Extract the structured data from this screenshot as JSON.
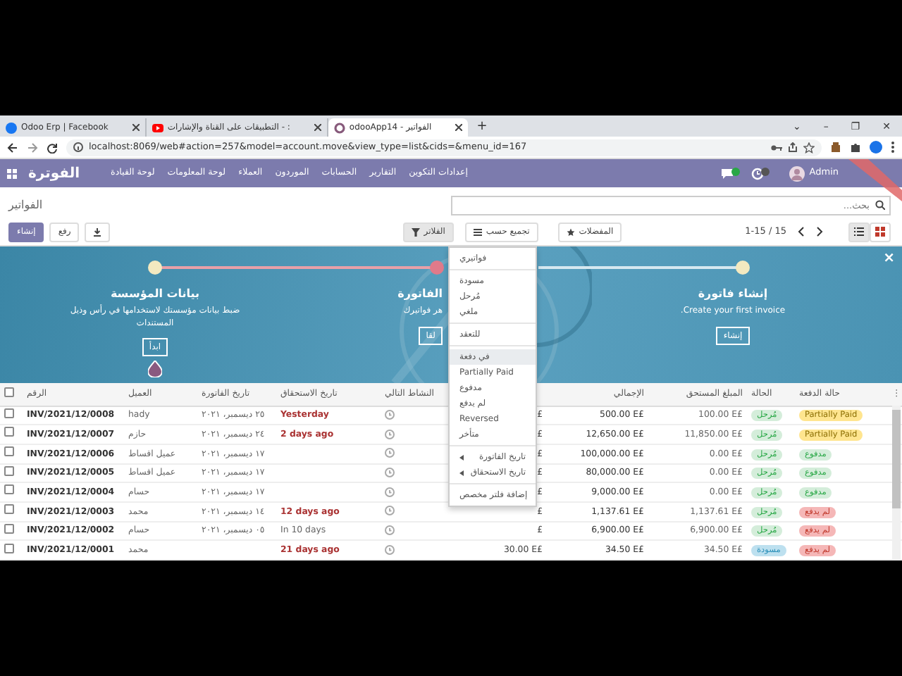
{
  "browser": {
    "tabs": [
      {
        "title": "odooApp14 - الفواتير",
        "selected": true
      },
      {
        "title": "التطبيقات على القناة والإشارات - :",
        "selected": false
      },
      {
        "title": "Odoo Erp | Facebook",
        "selected": false
      }
    ],
    "new_tab": "+",
    "window_controls": [
      "✕",
      "❐",
      "–",
      "⌄"
    ],
    "url": "localhost:8069/web#action=257&model=account.move&view_type=list&cids=&menu_id=167"
  },
  "navbar": {
    "app": "الفوترة",
    "menus": [
      "إعدادات التكوين",
      "التقارير",
      "الحسابات",
      "الموردون",
      "العملاء",
      "لوحة المعلومات",
      "لوحة القيادة"
    ],
    "user": "Admin"
  },
  "control_panel": {
    "title": "الفواتير",
    "search_placeholder": "بحث...",
    "buttons": [
      "رفع",
      "إنشاء"
    ],
    "filters": [
      {
        "label": "المفضلات",
        "selected": false
      },
      {
        "label": "تجميع حسب",
        "selected": false
      },
      {
        "label": "الفلاتر",
        "selected": true
      }
    ],
    "pager": "1-15 / 15",
    "views": [
      {
        "kind": "list",
        "selected": true
      },
      {
        "kind": "kanban",
        "selected": false
      }
    ]
  },
  "banner": {
    "close": "×",
    "steps": [
      {
        "title": "إنشاء فاتورة",
        "description": "Create your first invoice.",
        "button": "إنشاء",
        "current": false
      },
      {
        "title": "الفاتورة",
        "description": "هر فواتيرك",
        "button": "لقا",
        "current": true
      },
      {
        "title": "بيانات المؤسسة",
        "description": "ضبط بيانات مؤسستك لاستخدامها في رأس وذيل المستندات",
        "button": "ابدأ",
        "current": false
      }
    ]
  },
  "filter_menu": [
    {
      "kind": "item",
      "label": "فواتيري",
      "selected": false
    },
    {
      "kind": "divider"
    },
    {
      "kind": "item",
      "label": "مسودة",
      "selected": false
    },
    {
      "kind": "item",
      "label": "مُرحل",
      "selected": false
    },
    {
      "kind": "item",
      "label": "ملغي",
      "selected": false
    },
    {
      "kind": "divider"
    },
    {
      "kind": "item",
      "label": "للتعقد",
      "selected": false
    },
    {
      "kind": "divider"
    },
    {
      "kind": "item",
      "label": "في دفعة",
      "selected": true
    },
    {
      "kind": "item",
      "label": "Partially Paid",
      "selected": false
    },
    {
      "kind": "item",
      "label": "مدفوع",
      "selected": false
    },
    {
      "kind": "item",
      "label": "لم يدفع",
      "selected": false
    },
    {
      "kind": "item",
      "label": "Reversed",
      "selected": false
    },
    {
      "kind": "item",
      "label": "متأخر",
      "selected": false
    },
    {
      "kind": "divider"
    },
    {
      "kind": "submenu",
      "label": "تاريخ الفاتورة",
      "selected": false
    },
    {
      "kind": "submenu",
      "label": "تاريخ الاستحقاق",
      "selected": false
    },
    {
      "kind": "divider"
    },
    {
      "kind": "item",
      "label": "إضافة فلتر مخصص",
      "selected": false
    }
  ],
  "table": {
    "columns": [
      "حالة الدفعة",
      "الحالة",
      "المبلغ المستحق",
      "الإجمالي",
      "النشاط التالي",
      "تاريخ الاستحقاق",
      "تاريخ الفاتورة",
      "العميل",
      "الرقم"
    ],
    "menu": "⋮",
    "all_checked": false,
    "rows": [
      {
        "checked": false,
        "number": "INV/2021/12/0008",
        "customer": "hady",
        "invoice_date": "٢٥ ديسمبر، ٢٠٢١",
        "due_date": "Yesterday",
        "overdue": true,
        "column_7": "£",
        "total": "500.00 E£",
        "amount_due": "100.00 E£",
        "state": {
          "label": "مُرحل",
          "kind": "posted"
        },
        "payment": {
          "label": "Partially Paid",
          "kind": "partial"
        }
      },
      {
        "checked": false,
        "number": "INV/2021/12/0007",
        "customer": "حازم",
        "invoice_date": "٢٤ ديسمبر، ٢٠٢١",
        "due_date": "2 days ago",
        "overdue": true,
        "column_7": "£",
        "total": "12,650.00 E£",
        "amount_due": "11,850.00 E£",
        "state": {
          "label": "مُرحل",
          "kind": "posted"
        },
        "payment": {
          "label": "Partially Paid",
          "kind": "partial"
        }
      },
      {
        "checked": false,
        "number": "INV/2021/12/0006",
        "customer": "عميل اقساط",
        "invoice_date": "١٧ ديسمبر، ٢٠٢١",
        "column_7": "£",
        "total": "100,000.00 E£",
        "amount_due": "0.00 E£",
        "state": {
          "label": "مُرحل",
          "kind": "posted"
        },
        "payment": {
          "label": "مدفوع",
          "kind": "paid"
        }
      },
      {
        "checked": false,
        "number": "INV/2021/12/0005",
        "customer": "عميل اقساط",
        "invoice_date": "١٧ ديسمبر، ٢٠٢١",
        "column_7": "£",
        "total": "80,000.00 E£",
        "amount_due": "0.00 E£",
        "state": {
          "label": "مُرحل",
          "kind": "posted"
        },
        "payment": {
          "label": "مدفوع",
          "kind": "paid"
        }
      },
      {
        "checked": false,
        "number": "INV/2021/12/0004",
        "customer": "حسام",
        "invoice_date": "١٧ ديسمبر، ٢٠٢١",
        "column_7": "£",
        "total": "9,000.00 E£",
        "amount_due": "0.00 E£",
        "state": {
          "label": "مُرحل",
          "kind": "posted"
        },
        "payment": {
          "label": "مدفوع",
          "kind": "paid"
        }
      },
      {
        "checked": false,
        "number": "INV/2021/12/0003",
        "customer": "محمد",
        "invoice_date": "١٤ ديسمبر، ٢٠٢١",
        "due_date": "12 days ago",
        "overdue": true,
        "column_7": "£",
        "total": "1,137.61 E£",
        "amount_due": "1,137.61 E£",
        "state": {
          "label": "مُرحل",
          "kind": "posted"
        },
        "payment": {
          "label": "لم يدفع",
          "kind": "not_paid"
        }
      },
      {
        "checked": false,
        "number": "INV/2021/12/0002",
        "customer": "حسام",
        "invoice_date": "٠٥ ديسمبر، ٢٠٢١",
        "due_date": "In 10 days",
        "overdue": false,
        "column_7": "£",
        "total": "6,900.00 E£",
        "amount_due": "6,900.00 E£",
        "state": {
          "label": "مُرحل",
          "kind": "posted"
        },
        "payment": {
          "label": "لم يدفع",
          "kind": "not_paid"
        }
      },
      {
        "checked": false,
        "number": "INV/2021/12/0001",
        "customer": "محمد",
        "due_date": "21 days ago",
        "overdue": true,
        "column_7": "30.00 E£",
        "total": "34.50 E£",
        "amount_due": "34.50 E£",
        "state": {
          "label": "مسودة",
          "kind": "draft"
        },
        "payment": {
          "label": "لم يدفع",
          "kind": "not_paid"
        }
      }
    ]
  }
}
